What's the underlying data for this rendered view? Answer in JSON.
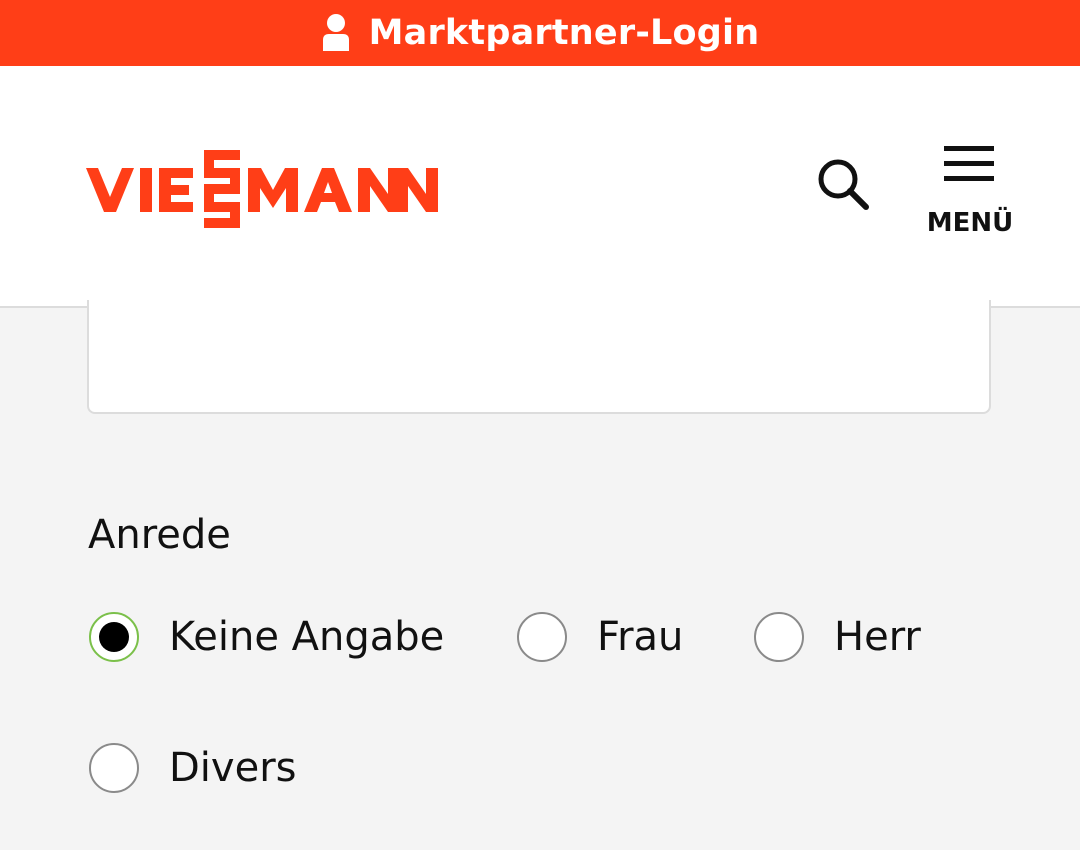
{
  "topbar": {
    "login_label": "Marktpartner-Login",
    "icon": "user-icon"
  },
  "header": {
    "logo_text": "VIESSMANN",
    "search_icon": "search-icon",
    "menu_icon": "hamburger-menu-icon",
    "menu_label": "MENÜ"
  },
  "colors": {
    "brand": "#ff3e17",
    "radio_selected_border": "#7bc04a",
    "background": "#f4f4f4"
  },
  "form": {
    "anrede_label": "Anrede",
    "selected": "Keine Angabe",
    "options": [
      {
        "label": "Keine Angabe",
        "checked": true
      },
      {
        "label": "Frau",
        "checked": false
      },
      {
        "label": "Herr",
        "checked": false
      },
      {
        "label": "Divers",
        "checked": false
      }
    ]
  }
}
